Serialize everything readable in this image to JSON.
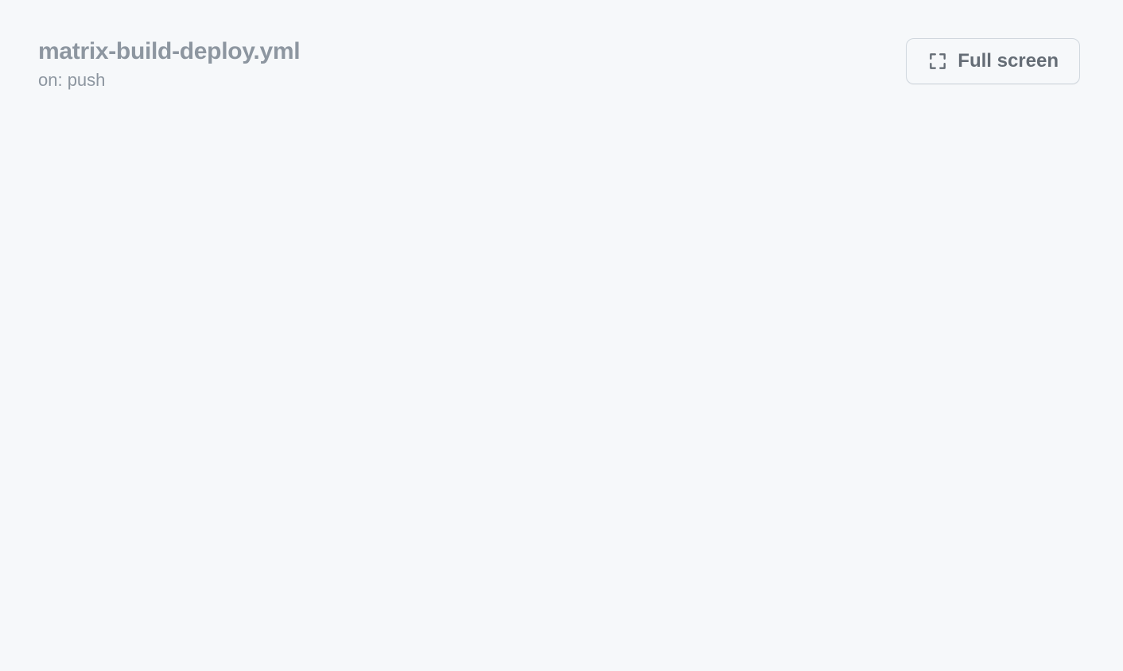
{
  "header": {
    "workflow_filename": "matrix-build-deploy.yml",
    "trigger_label": "on: push",
    "fullscreen_label": "Full screen"
  }
}
